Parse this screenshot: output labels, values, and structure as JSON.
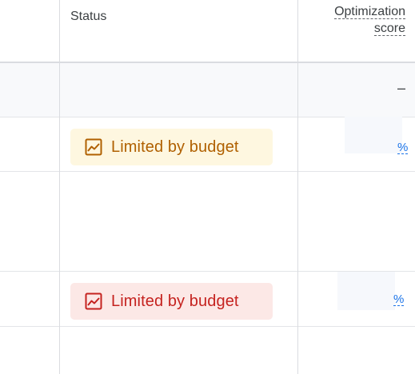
{
  "header": {
    "status_label": "Status",
    "optimization_line1": "Optimization",
    "optimization_line2": "score"
  },
  "summary_row": {
    "optimization_score": "–"
  },
  "rows": [
    {
      "status": "Limited by budget",
      "status_type": "warning",
      "status_icon": "trending-chart-icon",
      "optimization_score": "%"
    },
    {
      "status": "Limited by budget",
      "status_type": "error",
      "status_icon": "trending-chart-icon",
      "optimization_score": "%"
    }
  ],
  "colors": {
    "warning_bg": "#fef7e0",
    "warning_text": "#b06000",
    "error_bg": "#fce8e6",
    "error_text": "#c5221f",
    "link": "#1a73e8"
  }
}
